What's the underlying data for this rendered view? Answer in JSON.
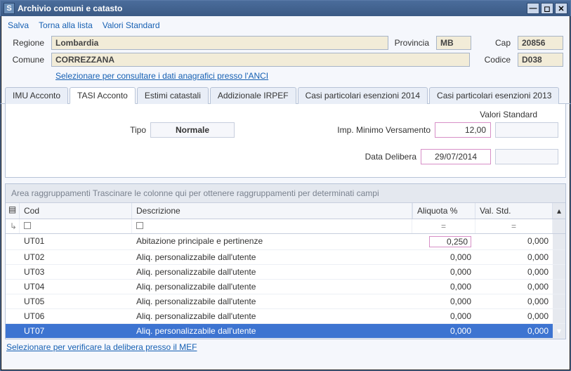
{
  "window": {
    "title": "Archivio comuni e catasto"
  },
  "menu": {
    "salva": "Salva",
    "torna": "Torna alla lista",
    "valori_std": "Valori Standard"
  },
  "labels": {
    "regione": "Regione",
    "provincia": "Provincia",
    "cap": "Cap",
    "comune": "Comune",
    "codice": "Codice",
    "tipo": "Tipo",
    "imp_min": "Imp. Minimo Versamento",
    "data_delibera": "Data Delibera",
    "valori_standard": "Valori Standard",
    "group_bar_prefix": "Area raggruppamenti",
    "group_bar_hint": "Trascinare le colonne qui per ottenere raggruppamenti per determinati campi"
  },
  "form": {
    "regione": "Lombardia",
    "provincia": "MB",
    "cap": "20856",
    "comune": "CORREZZANA",
    "codice": "D038"
  },
  "links": {
    "anci": "Selezionare per consultare i dati anagrafici presso l'ANCI",
    "mef": "Selezionare per verificare la delibera presso il MEF"
  },
  "tabs": [
    "IMU Acconto",
    "TASI Acconto",
    "Estimi catastali",
    "Addizionale IRPEF",
    "Casi particolari esenzioni 2014",
    "Casi particolari esenzioni 2013"
  ],
  "active_tab": 1,
  "panel": {
    "tipo": "Normale",
    "imp_min": "12,00",
    "data_delibera": "29/07/2014"
  },
  "grid": {
    "headers": {
      "cod": "Cod",
      "descrizione": "Descrizione",
      "aliquota": "Aliquota %",
      "val_std": "Val. Std."
    },
    "filter_symbols": {
      "box": "▢",
      "eq": "="
    },
    "rows": [
      {
        "cod": "UT01",
        "desc": "Abitazione principale e pertinenze",
        "aliq": "0,250",
        "aliq_hl": true,
        "std": "0,000",
        "selected": false
      },
      {
        "cod": "UT02",
        "desc": "Aliq. personalizzabile dall'utente",
        "aliq": "0,000",
        "aliq_hl": false,
        "std": "0,000",
        "selected": false
      },
      {
        "cod": "UT03",
        "desc": "Aliq. personalizzabile dall'utente",
        "aliq": "0,000",
        "aliq_hl": false,
        "std": "0,000",
        "selected": false
      },
      {
        "cod": "UT04",
        "desc": "Aliq. personalizzabile dall'utente",
        "aliq": "0,000",
        "aliq_hl": false,
        "std": "0,000",
        "selected": false
      },
      {
        "cod": "UT05",
        "desc": "Aliq. personalizzabile dall'utente",
        "aliq": "0,000",
        "aliq_hl": false,
        "std": "0,000",
        "selected": false
      },
      {
        "cod": "UT06",
        "desc": "Aliq. personalizzabile dall'utente",
        "aliq": "0,000",
        "aliq_hl": false,
        "std": "0,000",
        "selected": false
      },
      {
        "cod": "UT07",
        "desc": "Aliq. personalizzabile dall'utente",
        "aliq": "0,000",
        "aliq_hl": false,
        "std": "0,000",
        "selected": true
      }
    ]
  }
}
